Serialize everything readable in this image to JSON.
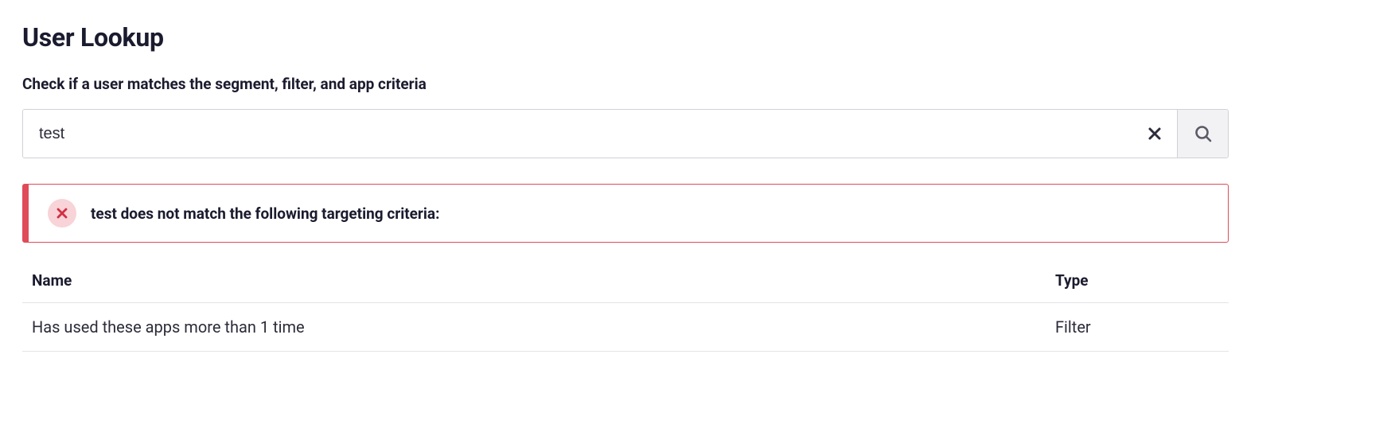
{
  "header": {
    "title": "User Lookup",
    "subtitle": "Check if a user matches the segment, filter, and app criteria"
  },
  "search": {
    "value": "test",
    "placeholder": ""
  },
  "alert": {
    "message": "test does not match the following targeting criteria:"
  },
  "table": {
    "columns": {
      "name": "Name",
      "type": "Type"
    },
    "rows": [
      {
        "name": "Has used these apps more than 1 time",
        "type": "Filter"
      }
    ]
  },
  "colors": {
    "danger": "#e04b5a",
    "danger_bg": "#f8d3d7",
    "border": "#d1d1d6",
    "text": "#1b1b2f"
  }
}
